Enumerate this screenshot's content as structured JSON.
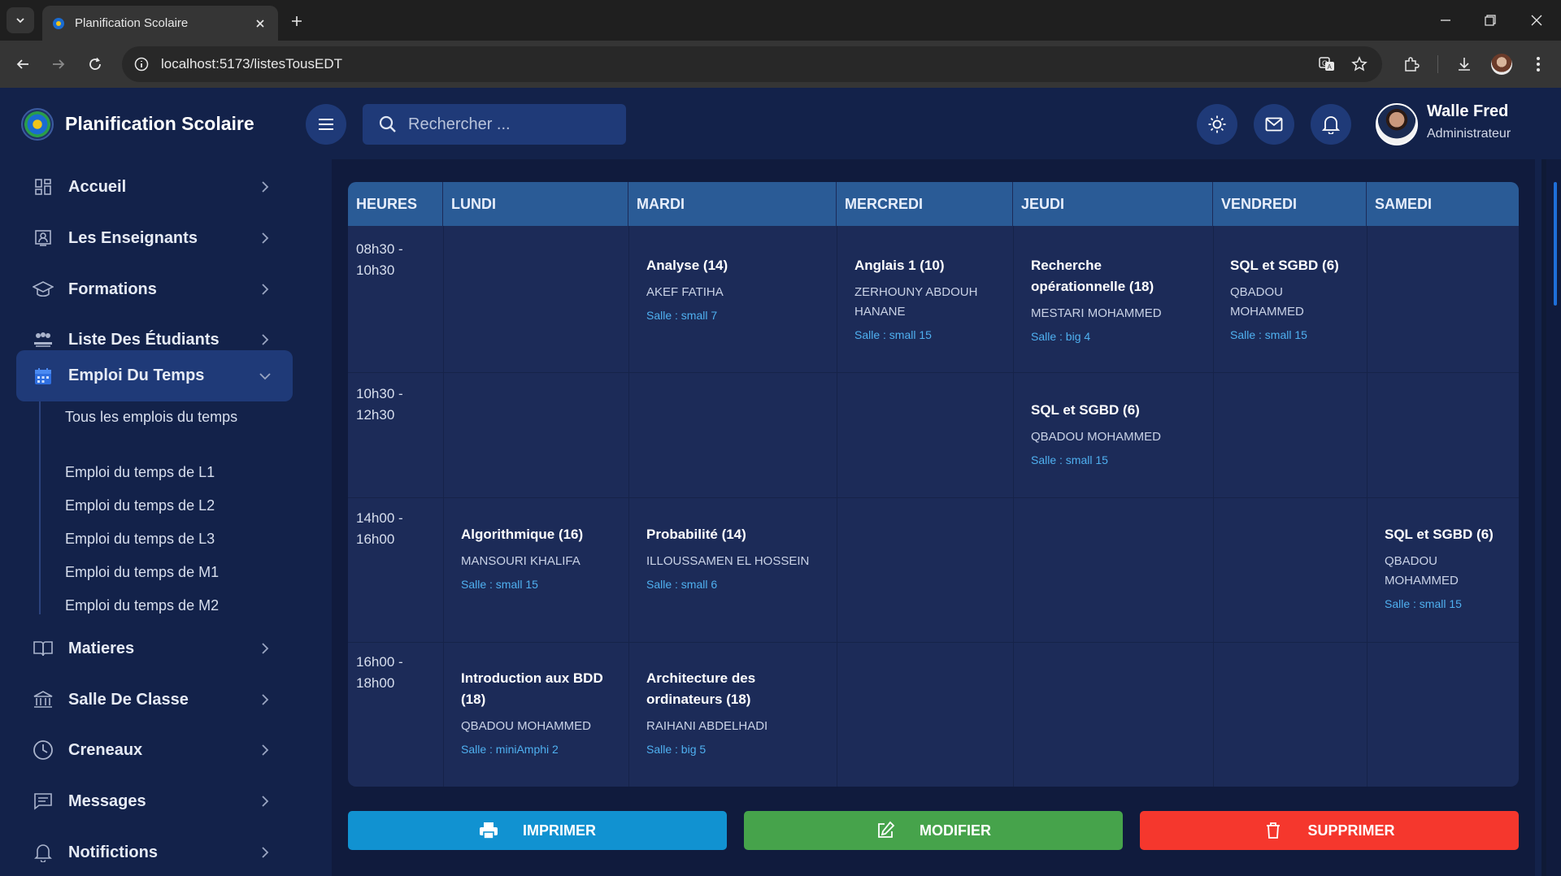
{
  "browser": {
    "tab_title": "Planification Scolaire",
    "url": "localhost:5173/listesTousEDT"
  },
  "header": {
    "app_title": "Planification Scolaire",
    "search_placeholder": "Rechercher ...",
    "user_name": "Walle Fred",
    "user_role": "Administrateur"
  },
  "sidebar": {
    "items": [
      {
        "label": "Accueil",
        "icon": "dashboard-icon"
      },
      {
        "label": "Les Enseignants",
        "icon": "teacher-icon"
      },
      {
        "label": "Formations",
        "icon": "graduation-cap-icon"
      },
      {
        "label": "Liste Des Étudiants",
        "icon": "students-icon"
      },
      {
        "label": "Emploi Du Temps",
        "icon": "calendar-icon",
        "expanded": true
      },
      {
        "label": "Matieres",
        "icon": "book-icon"
      },
      {
        "label": "Salle De Classe",
        "icon": "building-icon"
      },
      {
        "label": "Creneaux",
        "icon": "clock-icon"
      },
      {
        "label": "Messages",
        "icon": "message-icon"
      },
      {
        "label": "Notifictions",
        "icon": "bell-icon"
      }
    ],
    "sub_items": [
      "Tous les emplois du temps",
      "Emploi du temps de L1",
      "Emploi du temps de L2",
      "Emploi du temps de L3",
      "Emploi du temps de M1",
      "Emploi du temps de M2"
    ]
  },
  "timetable": {
    "columns": [
      "HEURES",
      "LUNDI",
      "MARDI",
      "MERCREDI",
      "JEUDI",
      "VENDREDI",
      "SAMEDI"
    ],
    "hours": [
      {
        "start": "08h30 -",
        "end": "10h30"
      },
      {
        "start": "10h30 -",
        "end": "12h30"
      },
      {
        "start": "14h00 -",
        "end": "16h00"
      },
      {
        "start": "16h00 -",
        "end": "18h00"
      }
    ],
    "sessions": [
      {
        "row": 0,
        "day": "MARDI",
        "course": "Analyse (14)",
        "teacher": "AKEF FATIHA",
        "room": "Salle : small 7"
      },
      {
        "row": 0,
        "day": "MERCREDI",
        "course": "Anglais 1 (10)",
        "teacher": "ZERHOUNY ABDOUH HANANE",
        "room": "Salle : small 15"
      },
      {
        "row": 0,
        "day": "JEUDI",
        "course": "Recherche opérationnelle (18)",
        "teacher": "MESTARI MOHAMMED",
        "room": "Salle : big 4"
      },
      {
        "row": 0,
        "day": "VENDREDI",
        "course": "SQL et SGBD (6)",
        "teacher": "QBADOU MOHAMMED",
        "room": "Salle : small 15"
      },
      {
        "row": 1,
        "day": "JEUDI",
        "course": "SQL et SGBD (6)",
        "teacher": "QBADOU MOHAMMED",
        "room": "Salle : small 15"
      },
      {
        "row": 2,
        "day": "LUNDI",
        "course": "Algorithmique (16)",
        "teacher": "MANSOURI KHALIFA",
        "room": "Salle : small 15"
      },
      {
        "row": 2,
        "day": "MARDI",
        "course": "Probabilité (14)",
        "teacher": "ILLOUSSAMEN EL HOSSEIN",
        "room": "Salle : small 6"
      },
      {
        "row": 2,
        "day": "SAMEDI",
        "course": "SQL et SGBD (6)",
        "teacher": "QBADOU MOHAMMED",
        "room": "Salle : small 15"
      },
      {
        "row": 3,
        "day": "LUNDI",
        "course": "Introduction aux BDD (18)",
        "teacher": "QBADOU MOHAMMED",
        "room": "Salle : miniAmphi 2"
      },
      {
        "row": 3,
        "day": "MARDI",
        "course": "Architecture des ordinateurs (18)",
        "teacher": "RAIHANI ABDELHADI",
        "room": "Salle : big 5"
      }
    ]
  },
  "actions": {
    "print_label": "IMPRIMER",
    "edit_label": "MODIFIER",
    "delete_label": "SUPPRIMER"
  },
  "colors": {
    "background": "#13224a",
    "table_header": "#2a5b96",
    "room_text": "#4fb0f0",
    "print": "#1192d1",
    "edit": "#46a34b",
    "delete": "#f5372d"
  }
}
